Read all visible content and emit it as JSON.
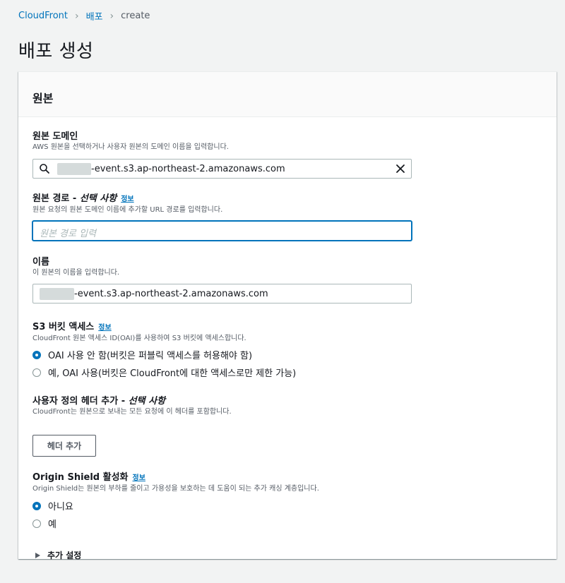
{
  "breadcrumb": {
    "items": [
      "CloudFront",
      "배포"
    ],
    "current": "create"
  },
  "page_title": "배포 생성",
  "panel": {
    "title": "원본"
  },
  "origin_domain": {
    "label": "원본 도메인",
    "description": "AWS 원본을 선택하거나 사용자 원본의 도메인 이름을 입력합니다.",
    "value": "-event.s3.ap-northeast-2.amazonaws.com"
  },
  "origin_path": {
    "label": "원본 경로 - ",
    "label_optional": "선택 사항",
    "info": "정보",
    "description": "원본 요청의 원본 도메인 이름에 추가할 URL 경로를 입력합니다.",
    "placeholder": "원본 경로 입력"
  },
  "name": {
    "label": "이름",
    "description": "이 원본의 이름을 입력합니다.",
    "value": "-event.s3.ap-northeast-2.amazonaws.com"
  },
  "s3_access": {
    "label": "S3 버킷 액세스",
    "info": "정보",
    "description": "CloudFront 원본 액세스 ID(OAI)를 사용하여 S3 버킷에 액세스합니다.",
    "options": [
      {
        "label": "OAI 사용 안 함(버킷은 퍼블릭 액세스를 허용해야 함)",
        "selected": true
      },
      {
        "label": "예, OAI 사용(버킷은 CloudFront에 대한 액세스로만 제한 가능)",
        "selected": false
      }
    ]
  },
  "custom_headers": {
    "label": "사용자 정의 헤더 추가 - ",
    "label_optional": "선택 사항",
    "description": "CloudFront는 원본으로 보내는 모든 요청에 이 헤더를 포함합니다.",
    "button": "헤더 추가"
  },
  "origin_shield": {
    "label": "Origin Shield 활성화",
    "info": "정보",
    "description": "Origin Shield는 원본의 부하를 줄이고 가용성을 보호하는 데 도움이 되는 추가 캐싱 계층입니다.",
    "options": [
      {
        "label": "아니요",
        "selected": true
      },
      {
        "label": "예",
        "selected": false
      }
    ]
  },
  "additional_settings": {
    "label": "추가 설정"
  },
  "colors": {
    "accent": "#0073bb",
    "background": "#f2f3f3"
  }
}
